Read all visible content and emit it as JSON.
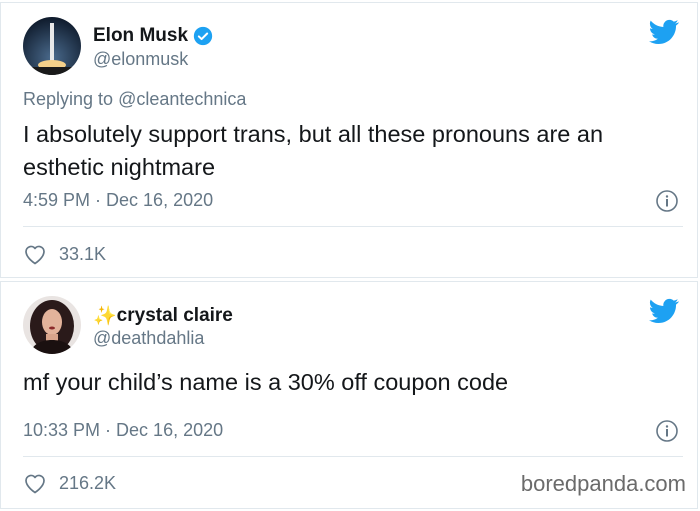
{
  "tweets": [
    {
      "name": "Elon Musk",
      "handle": "@elonmusk",
      "verified": true,
      "replying_prefix": "Replying to",
      "replying_to": "@cleantechnica",
      "text": "I absolutely support trans, but all these pronouns are an esthetic nightmare",
      "timestamp": "4:59 PM · Dec 16, 2020",
      "likes": "33.1K"
    },
    {
      "name_prefix": "✨",
      "name": "crystal claire",
      "handle": "@deathdahlia",
      "text": "mf your child’s name is a 30% off coupon code",
      "timestamp": "10:33 PM · Dec 16, 2020",
      "likes": "216.2K"
    }
  ],
  "watermark": "boredpanda.com",
  "colors": {
    "twitter_blue": "#1da1f2",
    "text_primary": "#14171a",
    "text_secondary": "#657786",
    "divider": "#e1e8ed"
  }
}
